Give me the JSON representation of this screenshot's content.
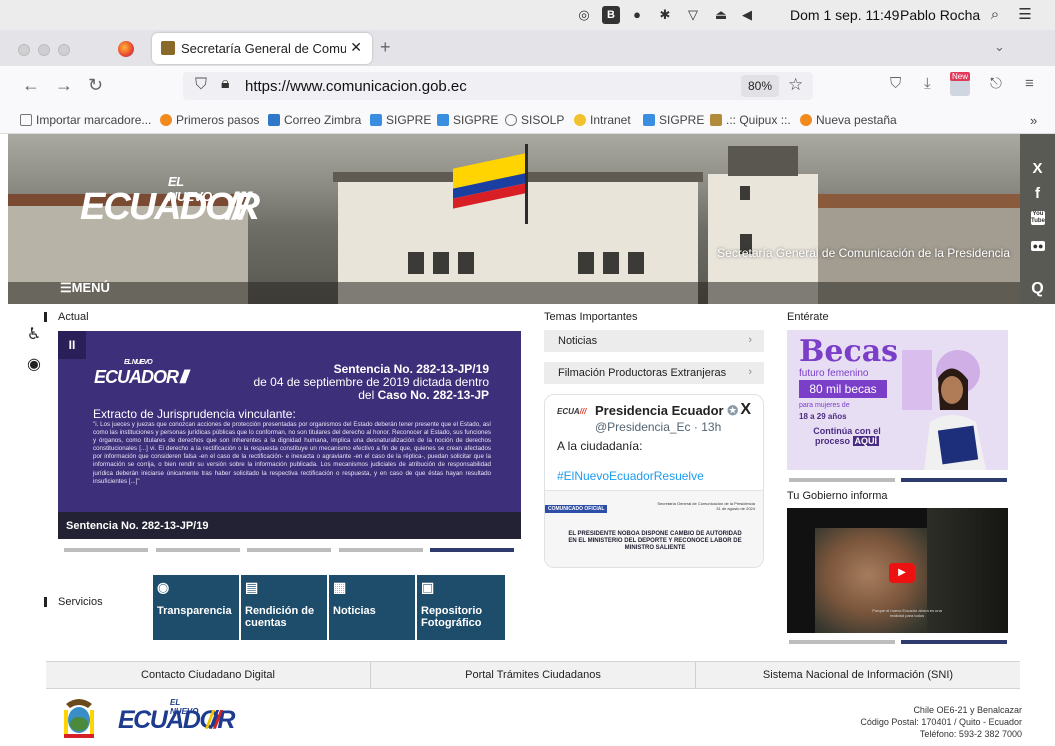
{
  "menubar": {
    "datetime": "Dom 1 sep. 11:49",
    "user": "Pablo Rocha"
  },
  "tabs": {
    "active_title": "Secretaría General de Comunica",
    "close": "✕",
    "new_tab": "+"
  },
  "nav": {
    "url": "https://www.comunicacion.gob.ec",
    "zoom": "80%",
    "new_badge": "New"
  },
  "bookmarks": [
    {
      "label": "Importar marcadore...",
      "color": "#ffffff"
    },
    {
      "label": "Primeros pasos",
      "color": "#f28b1d"
    },
    {
      "label": "Correo Zimbra",
      "color": "#2d78c8"
    },
    {
      "label": "SIGPRE",
      "color": "#3a8ee0"
    },
    {
      "label": "SIGPRE",
      "color": "#3a8ee0"
    },
    {
      "label": "SISOLP",
      "color": "#ffffff"
    },
    {
      "label": "Intranet",
      "color": "#f2c12e"
    },
    {
      "label": "SIGPRE",
      "color": "#3a8ee0"
    },
    {
      "label": ".:: Quipux ::.",
      "color": "#b28a3c"
    },
    {
      "label": "Nueva pestaña",
      "color": "#f28b1d"
    }
  ],
  "hero": {
    "logo_small": "EL NUEVO",
    "logo_big": "ECUADOR",
    "subtitle": "Secretaría General de Comunicación de la Presidencia",
    "menu": "MENÚ"
  },
  "social": [
    "X",
    "f",
    "You Tube",
    "●●",
    "Q"
  ],
  "actual": {
    "title": "Actual",
    "pause": "II",
    "logo_small": "EL NUEVO",
    "logo_big": "ECUADOR",
    "heading_bold": "Sentencia No. 282-13-JP/19",
    "heading_line2": "de 04 de septiembre de 2019 dictada dentro",
    "heading_line3_pre": "del ",
    "heading_line3_bold": "Caso No. 282-13-JP",
    "subheading": "Extracto de Jurisprudencia vinculante:",
    "body": "\"i. Los jueces y juezas que conozcan acciones de protección presentadas por organismos del Estado deberán tener presente que el Estado, así como las instituciones y personas jurídicas públicas que lo conforman, no son titulares del derecho al honor. Reconocer al Estado, sus funciones y órganos, como titulares de derechos que son inherentes a la dignidad humana, implica una desnaturalización de la noción de derechos constitucionales [...] vi. El derecho a la rectificación o la respuesta constituye un mecanismo efectivo a fin de que, quienes se crean afectados por información que consideren falsa -en el caso de la rectificación- e inexacta o agraviante -en el caso de la réplica-, puedan solicitar que la información se corrija, o bien rendir su versión sobre la información publicada. Los mecanismos judiciales de atribución de responsabilidad jurídica deberán iniciarse únicamente tras haber solicitado la respectiva rectificación o respuesta, y en caso de que éstas hayan resultado insuficientes [...]\"",
    "caption": "Sentencia No. 282-13-JP/19"
  },
  "temas": {
    "title": "Temas Importantes",
    "items": [
      "Noticias",
      "Filmación Productoras Extranjeras"
    ],
    "arrow": "›"
  },
  "tweet": {
    "name": "Presidencia Ecuador",
    "handle": "@Presidencia_Ec · 13h",
    "text": "A la ciudadanía:",
    "hashtag": "#ElNuevoEcuadorResuelve",
    "x_icon": "X",
    "img_badge": "COMUNICADO OFICIAL",
    "img_source": "Secretaría General de Comunicación de la Presidencia",
    "img_date": "31 de agosto de 2024",
    "img_headline": "EL PRESIDENTE NOBOA DISPONE CAMBIO DE AUTORIDAD EN EL MINISTERIO DEL DEPORTE Y RECONOCE LABOR DE MINISTRO SALIENTE"
  },
  "enterate": {
    "title": "Entérate",
    "becas": "Becas",
    "futuro": "futuro femenino",
    "mil": "80 mil becas",
    "para": "para mujeres de",
    "edad": "18 a 29 años",
    "continua": "Continúa con el proceso",
    "aqui": "AQUÍ"
  },
  "gobierno": {
    "title": "Tu Gobierno informa",
    "caption": "Porque el nuevo Ecuador ahora es una realidad para todos"
  },
  "servicios": {
    "title": "Servicios",
    "items": [
      {
        "icon": "◉",
        "label": "Transparencia"
      },
      {
        "icon": "▤",
        "label": "Rendición de cuentas"
      },
      {
        "icon": "▦",
        "label": "Noticias"
      },
      {
        "icon": "▣",
        "label": "Repositorio Fotográfico"
      }
    ]
  },
  "links": [
    "Contacto Ciudadano Digital",
    "Portal Trámites Ciudadanos",
    "Sistema Nacional de Información (SNI)"
  ],
  "footer": {
    "logo_small": "EL NUEVO",
    "logo_big": "ECUADOR",
    "address1": "Chile OE6-21 y Benalcazar",
    "address2": "Código Postal: 170401 / Quito - Ecuador",
    "address3": "Teléfono: 593-2 382 7000"
  },
  "colors": {
    "slider_bg": "#3d2f79",
    "service_bg": "#1e4d6b",
    "indicator_active": "#2e3a6e",
    "indicator_inactive": "#bcbcbc",
    "becas_purple": "#7a3ec8"
  }
}
